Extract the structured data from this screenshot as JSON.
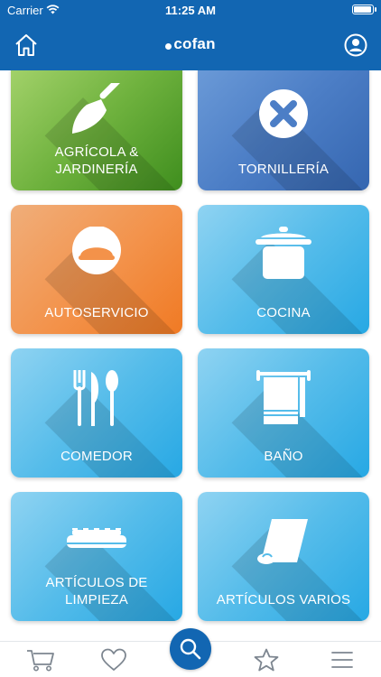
{
  "status_bar": {
    "carrier": "Carrier",
    "time": "11:25 AM",
    "battery_level": 1.0
  },
  "header": {
    "brand": "cofan",
    "home_icon": "home-icon",
    "account_icon": "user-circle-icon"
  },
  "categories": [
    {
      "label": "AGRÍCOLA &\nJARDINERÍA",
      "icon": "trowel-icon"
    },
    {
      "label": "TORNILLERÍA",
      "icon": "x-circle-icon"
    },
    {
      "label": "AUTOSERVICIO",
      "icon": "loaf-icon"
    },
    {
      "label": "COCINA",
      "icon": "pot-icon"
    },
    {
      "label": "COMEDOR",
      "icon": "cutlery-icon"
    },
    {
      "label": "BAÑO",
      "icon": "towel-rack-icon"
    },
    {
      "label": "ARTÍCULOS DE\nLIMPIEZA",
      "icon": "broom-icon"
    },
    {
      "label": "ARTÍCULOS VARIOS",
      "icon": "roll-icon"
    }
  ],
  "tabbar": [
    "cart-icon",
    "heart-icon",
    "search-icon",
    "star-icon",
    "menu-icon"
  ],
  "colors": {
    "brand_blue": "#1266b2",
    "green": "#6fb23e",
    "blue": "#4c7ec6",
    "orange": "#f3924a",
    "sky": "#55bcea"
  }
}
